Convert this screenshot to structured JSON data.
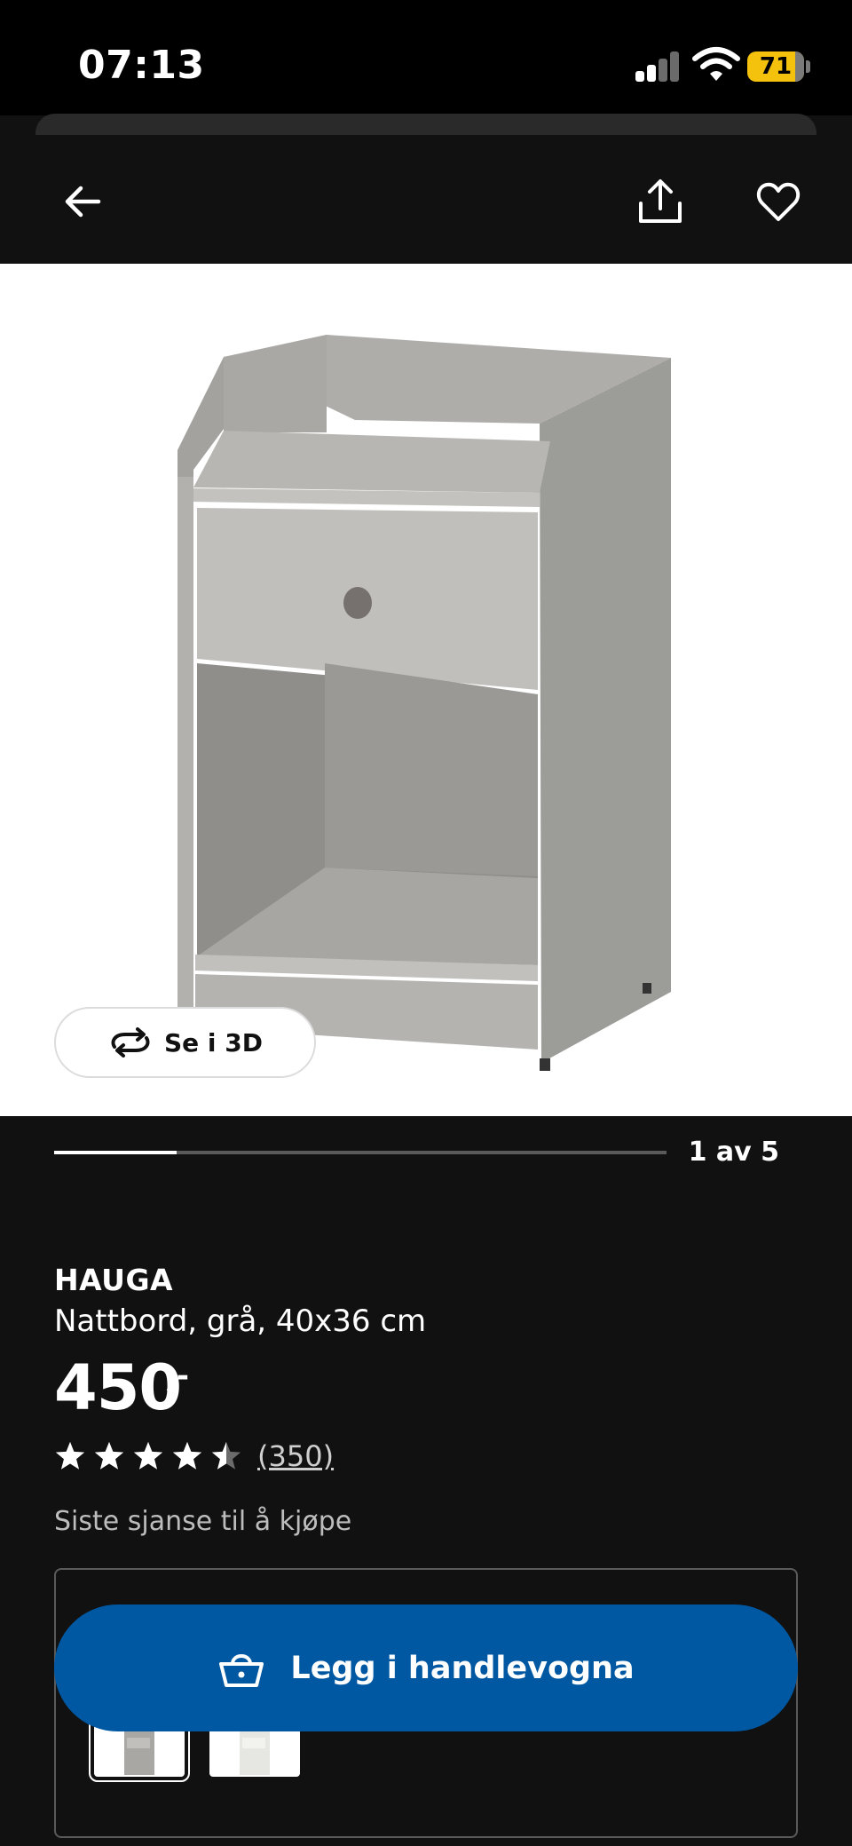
{
  "status_bar": {
    "time": "07:13",
    "battery": "71",
    "battery_color": "#f4c20d"
  },
  "nav": {
    "back_icon": "arrow-left-icon",
    "share_icon": "share-icon",
    "favorite_icon": "heart-icon"
  },
  "gallery": {
    "see_3d_label": "Se i 3D",
    "page_counter": "1 av 5",
    "current_index": 1,
    "total_images": 5
  },
  "product": {
    "brand": "HAUGA",
    "description": "Nattbord, grå, 40x36 cm",
    "price": "450",
    "price_suffix": ",-",
    "rating": 4.5,
    "rating_count": "(350)",
    "stock_note": "Siste sjanse til å kjøpe"
  },
  "cart": {
    "label": "Legg i handlevogna",
    "icon": "basket-icon",
    "color": "#0058a3"
  },
  "variants": [
    {
      "name": "grå",
      "selected": true
    },
    {
      "name": "hvit",
      "selected": false
    }
  ]
}
